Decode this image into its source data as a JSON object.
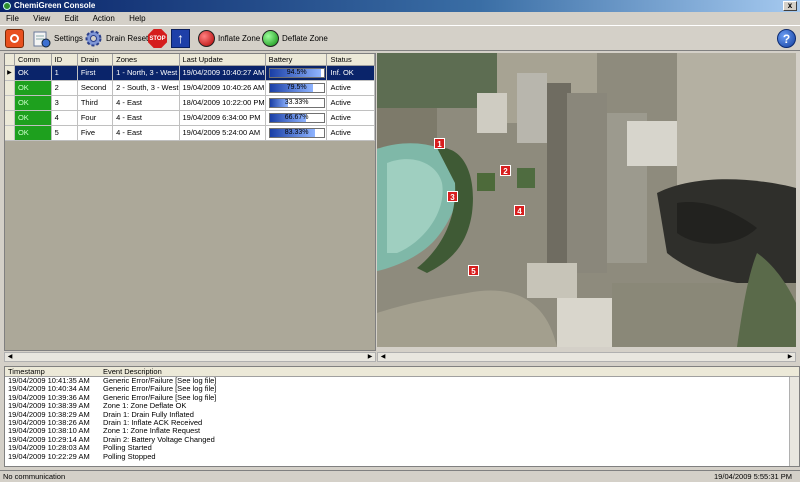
{
  "window": {
    "title": "ChemiGreen Console",
    "close_label": "x"
  },
  "menu": [
    "File",
    "View",
    "Edit",
    "Action",
    "Help"
  ],
  "toolbar": {
    "settings_label": "Settings",
    "drain_reset_label": "Drain Reset",
    "stop_label": "STOP",
    "inflate_label": "Inflate Zone",
    "deflate_label": "Deflate Zone",
    "help_label": "?"
  },
  "grid": {
    "columns": [
      "Comm",
      "ID",
      "Drain",
      "Zones",
      "Last Update",
      "Battery",
      "Status"
    ],
    "rows": [
      {
        "comm": "OK",
        "id": "1",
        "drain": "First",
        "zones": "1 - North, 3 - West",
        "last_update": "19/04/2009 10:40:27 AM",
        "battery": "94.5%",
        "battery_level": 0.945,
        "status": "Inf. OK",
        "selected": true
      },
      {
        "comm": "OK",
        "id": "2",
        "drain": "Second",
        "zones": "2 - South, 3 - West",
        "last_update": "19/04/2009 10:40:26 AM",
        "battery": "79.5%",
        "battery_level": 0.795,
        "status": "Active",
        "selected": false
      },
      {
        "comm": "OK",
        "id": "3",
        "drain": "Third",
        "zones": "4 - East",
        "last_update": "18/04/2009 10:22:00 PM",
        "battery": "33.33%",
        "battery_level": 0.3333,
        "status": "Active",
        "selected": false
      },
      {
        "comm": "OK",
        "id": "4",
        "drain": "Four",
        "zones": "4 - East",
        "last_update": "19/04/2009 6:34:00 PM",
        "battery": "66.67%",
        "battery_level": 0.6667,
        "status": "Active",
        "selected": false
      },
      {
        "comm": "OK",
        "id": "5",
        "drain": "Five",
        "zones": "4 - East",
        "last_update": "19/04/2009 5:24:00 AM",
        "battery": "83.33%",
        "battery_level": 0.8333,
        "status": "Active",
        "selected": false
      }
    ]
  },
  "map": {
    "markers": [
      "1",
      "2",
      "3",
      "4",
      "5"
    ]
  },
  "events": {
    "columns": [
      "Timestamp",
      "Event Description"
    ],
    "rows": [
      {
        "time": "19/04/2009 10:41:35 AM",
        "desc": "Generic Error/Failure [See log file]"
      },
      {
        "time": "19/04/2009 10:40:34 AM",
        "desc": "Generic Error/Failure [See log file]"
      },
      {
        "time": "19/04/2009 10:39:36 AM",
        "desc": "Generic Error/Failure [See log file]"
      },
      {
        "time": "19/04/2009 10:38:39 AM",
        "desc": "Zone 1: Zone Deflate OK"
      },
      {
        "time": "19/04/2009 10:38:29 AM",
        "desc": "Drain 1: Drain Fully Inflated"
      },
      {
        "time": "19/04/2009 10:38:26 AM",
        "desc": "Drain 1: Inflate ACK Received"
      },
      {
        "time": "19/04/2009 10:38:10 AM",
        "desc": "Zone 1: Zone Inflate Request"
      },
      {
        "time": "19/04/2009 10:29:14 AM",
        "desc": "Drain 2: Battery Voltage Changed"
      },
      {
        "time": "19/04/2009 10:28:03 AM",
        "desc": "Polling Started"
      },
      {
        "time": "19/04/2009 10:22:29 AM",
        "desc": "Polling Stopped"
      }
    ]
  },
  "status": {
    "left": "No communication",
    "right": "19/04/2009 5:55:31 PM"
  }
}
